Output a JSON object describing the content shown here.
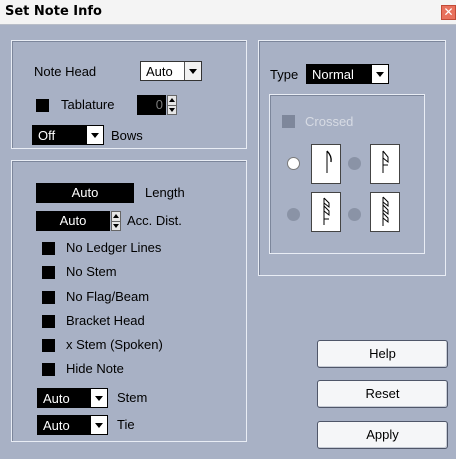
{
  "window": {
    "title": "Set Note Info"
  },
  "notehead": {
    "label": "Note Head",
    "value": "Auto",
    "tablature_label": "Tablature",
    "tablature_value": "0",
    "bows_value": "Off",
    "bows_label": "Bows"
  },
  "type": {
    "label": "Type",
    "value": "Normal",
    "crossed_label": "Crossed",
    "selected_variant": 1
  },
  "length": {
    "value": "Auto",
    "label": "Length"
  },
  "acc_dist": {
    "value": "Auto",
    "label": "Acc. Dist."
  },
  "options": [
    {
      "label": "No Ledger Lines"
    },
    {
      "label": "No Stem"
    },
    {
      "label": "No Flag/Beam"
    },
    {
      "label": "Bracket Head"
    },
    {
      "label": "x Stem (Spoken)"
    },
    {
      "label": "Hide Note"
    }
  ],
  "stem": {
    "value": "Auto",
    "label": "Stem"
  },
  "tie": {
    "value": "Auto",
    "label": "Tie"
  },
  "buttons": {
    "help": "Help",
    "reset": "Reset",
    "apply": "Apply"
  }
}
